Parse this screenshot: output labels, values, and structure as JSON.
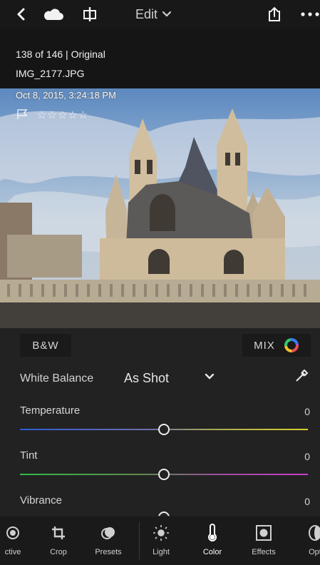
{
  "header": {
    "title": "Edit"
  },
  "photo_meta": {
    "count_line": "138 of 146 | Original",
    "filename": "IMG_2177.JPG",
    "datetime": "Oct 8, 2015, 3:24:18 PM",
    "stars": "☆☆☆☆☆"
  },
  "panel": {
    "bw_label": "B&W",
    "mix_label": "MIX",
    "white_balance": {
      "label": "White Balance",
      "value": "As Shot"
    },
    "sliders": [
      {
        "label": "Temperature",
        "value": "0"
      },
      {
        "label": "Tint",
        "value": "0"
      },
      {
        "label": "Vibrance",
        "value": "0"
      }
    ]
  },
  "nav": {
    "items": [
      {
        "label": "ctive",
        "icon": "selective-icon"
      },
      {
        "label": "Crop",
        "icon": "crop-icon"
      },
      {
        "label": "Presets",
        "icon": "presets-icon"
      },
      {
        "label": "Light",
        "icon": "sun-icon"
      },
      {
        "label": "Color",
        "icon": "thermometer-icon"
      },
      {
        "label": "Effects",
        "icon": "effects-icon"
      },
      {
        "label": "Opt",
        "icon": "optics-icon"
      }
    ]
  },
  "colors": {
    "accent": "#ffffff",
    "panel": "#222222",
    "temperature_left": "#2f5bd8",
    "temperature_right": "#d8d02a",
    "tint_left": "#33b94d",
    "tint_right": "#d03bd2"
  }
}
